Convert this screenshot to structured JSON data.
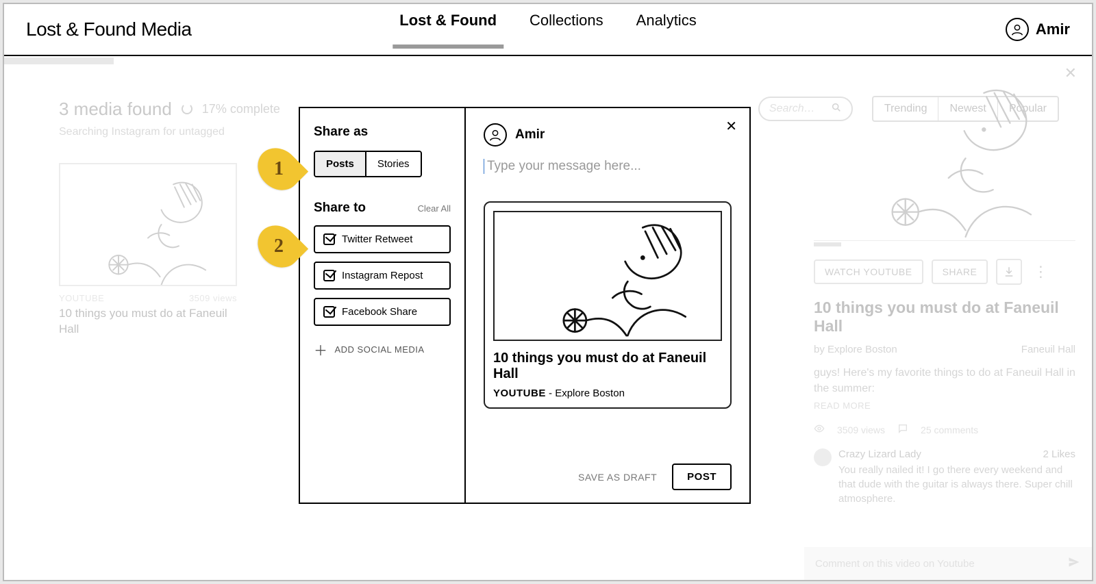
{
  "header": {
    "brand": "Lost & Found Media",
    "nav": [
      "Lost & Found",
      "Collections",
      "Analytics"
    ],
    "active_nav_index": 0,
    "user_name": "Amir"
  },
  "main": {
    "results_title": "3 media found",
    "progress_text": "17% complete",
    "sub_line": "Searching Instagram for untagged",
    "search_placeholder": "Search…",
    "filter_options": [
      "Trending",
      "Newest",
      "Popular"
    ],
    "card": {
      "source": "YOUTUBE",
      "views": "3509 views",
      "title": "10 things you must do at Faneuil Hall"
    }
  },
  "detail": {
    "watch_label": "WATCH YOUTUBE",
    "share_label": "SHARE",
    "title": "10 things you must do at Faneuil Hall",
    "by_line": "by Explore Boston",
    "location": "Faneuil Hall",
    "desc": "guys! Here's my favorite things to do at Faneuil Hall in the summer:",
    "read_more": "READ MORE",
    "stats_views": "3509 views",
    "stats_comments": "25 comments",
    "comment": {
      "author": "Crazy Lizard Lady",
      "likes": "2 Likes",
      "body": "You really nailed it! I go there every weekend and that dude with the guitar is always there. Super chill atmosphere."
    },
    "comment_placeholder": "Comment on this video on Youtube"
  },
  "modal": {
    "share_as_heading": "Share as",
    "share_as_tabs": [
      "Posts",
      "Stories"
    ],
    "share_as_active_index": 0,
    "share_to_heading": "Share to",
    "clear_all": "Clear All",
    "channels": [
      {
        "label": "Twitter Retweet",
        "checked": true
      },
      {
        "label": "Instagram Repost",
        "checked": true
      },
      {
        "label": "Facebook Share",
        "checked": true
      }
    ],
    "add_social": "ADD SOCIAL MEDIA",
    "composer_user": "Amir",
    "composer_placeholder": "Type your message here...",
    "preview": {
      "title": "10 things you must do at Faneuil Hall",
      "source": "YOUTUBE",
      "author": "Explore Boston"
    },
    "save_draft": "SAVE AS DRAFT",
    "post": "POST"
  },
  "annotations": {
    "a1": "1",
    "a2": "2"
  }
}
